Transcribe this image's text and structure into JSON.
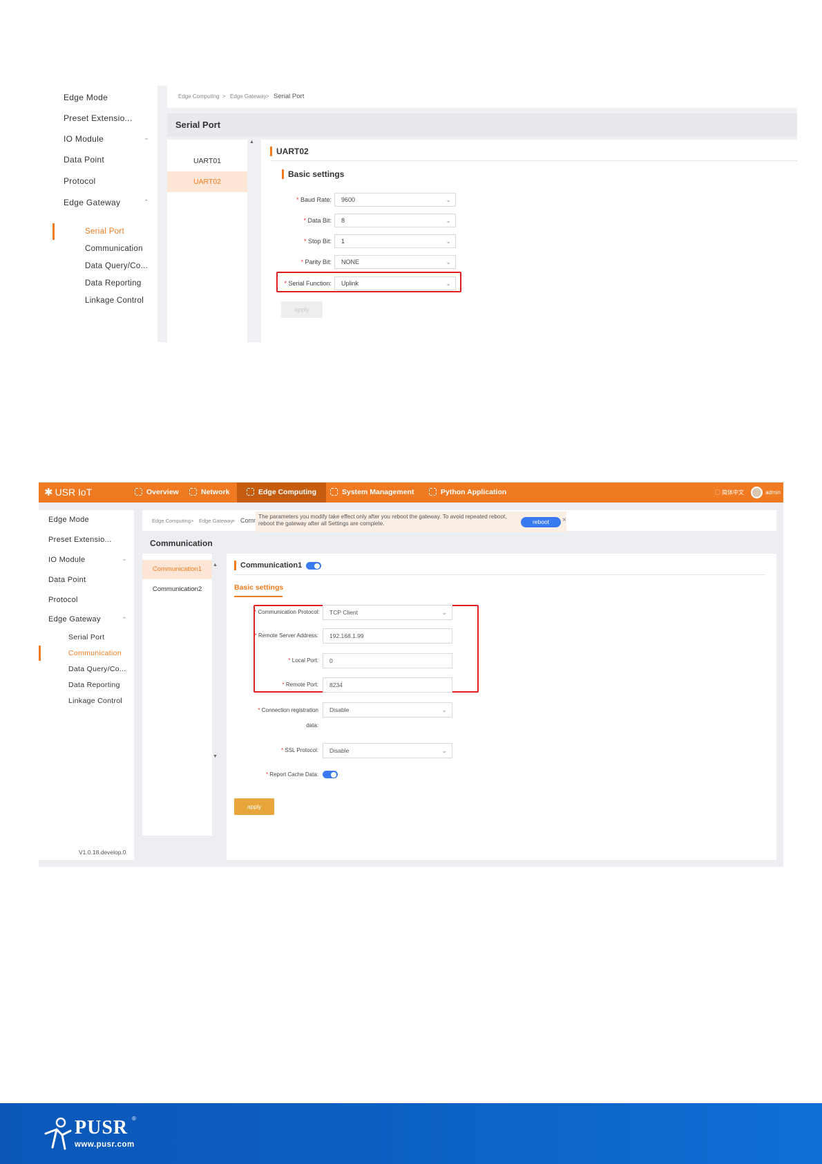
{
  "shot1": {
    "sidebar": {
      "items": [
        "Edge Mode",
        "Preset Extensio...",
        "IO Module",
        "Data Point",
        "Protocol",
        "Edge Gateway"
      ],
      "sub_items": [
        "Serial Port",
        "Communication",
        "Data Query/Co...",
        "Data Reporting",
        "Linkage Control"
      ],
      "active_sub": "Serial Port"
    },
    "breadcrumb": [
      "Edge Computing",
      "Edge Gateway",
      "Serial Port"
    ],
    "breadcrumb_sep": ">",
    "page_title": "Serial Port",
    "channels": [
      "UART01",
      "UART02"
    ],
    "selected_channel": "UART02",
    "section_title": "UART02",
    "basic_settings": "Basic settings",
    "fields": [
      {
        "label": "Baud Rate:",
        "value": "9600"
      },
      {
        "label": "Data Bit:",
        "value": "8"
      },
      {
        "label": "Stop Bit:",
        "value": "1"
      },
      {
        "label": "Parity Bit:",
        "value": "NONE"
      },
      {
        "label": "Serial Function:",
        "value": "Uplink"
      }
    ],
    "required_mark": "*",
    "apply_label": "apply"
  },
  "shot2": {
    "brand": "USR IoT",
    "nav": [
      "Overview",
      "Network",
      "Edge Computing",
      "System Management",
      "Python Application"
    ],
    "active_nav": "Edge Computing",
    "lang": "简体中文",
    "user": "admin",
    "sidebar": {
      "items": [
        "Edge Mode",
        "Preset Extensio...",
        "IO Module",
        "Data Point",
        "Protocol",
        "Edge Gateway"
      ],
      "sub_items": [
        "Serial Port",
        "Communication",
        "Data Query/Co...",
        "Data Reporting",
        "Linkage Control"
      ],
      "active_sub": "Communication",
      "version": "V1.0.18.develop.0"
    },
    "breadcrumb": [
      "Edge Computing",
      "Edge Gateway",
      "Comm"
    ],
    "breadcrumb_sep": ">",
    "notice": "The parameters you modify take effect only after you reboot the gateway. To avoid repeated reboot, reboot the gateway after all Settings are complete.",
    "reboot_label": "reboot",
    "close_label": "×",
    "page_title": "Communication",
    "channels": [
      "Communication1",
      "Communication2"
    ],
    "selected_channel": "Communication1",
    "section_title": "Communication1",
    "section_enabled": true,
    "basic_settings": "Basic settings",
    "fields": [
      {
        "label": "Communication Protocol:",
        "value": "TCP Client",
        "type": "select"
      },
      {
        "label": "Remote Server Address:",
        "value": "192.168.1.99",
        "type": "input"
      },
      {
        "label": "Local Port:",
        "value": "0",
        "type": "input"
      },
      {
        "label": "Remote Port:",
        "value": "8234",
        "type": "input"
      }
    ],
    "conn_reg": {
      "label_line1": "Connection registration",
      "label_line2": "data:",
      "value": "Disable"
    },
    "ssl": {
      "label": "SSL Protocol:",
      "value": "Disable"
    },
    "report_cache": {
      "label": "Report Cache Data:",
      "enabled": true
    },
    "required_mark": "*",
    "apply_label": "apply"
  },
  "footer": {
    "brand": "PUSR",
    "registered": "®",
    "url": "www.pusr.com"
  },
  "colors": {
    "accent": "#f37b1d",
    "nav": "#ef7a22",
    "toggle": "#3a7af0",
    "highlight_box": "#e02020",
    "footer": "#0d63c6"
  }
}
